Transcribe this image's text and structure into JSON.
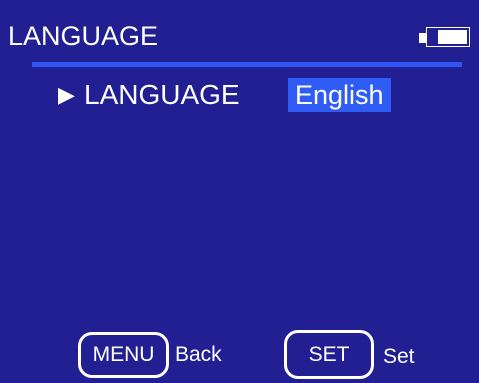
{
  "header": {
    "title": "LANGUAGE",
    "battery_icon": "battery-icon",
    "battery_level": 0.75
  },
  "setting": {
    "pointer_glyph": "▶",
    "pointer_icon": "play-pointer-icon",
    "label": "LANGUAGE",
    "value": "English"
  },
  "footer": {
    "menu_key": "MENU",
    "menu_caption": "Back",
    "set_key": "SET",
    "set_caption": "Set"
  },
  "colors": {
    "background": "#221f92",
    "accent": "#2f5cf5",
    "text": "#ffffff"
  }
}
